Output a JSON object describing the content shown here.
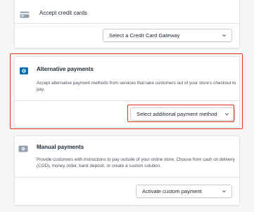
{
  "credit_cards": {
    "title": "Accept credit cards",
    "select_label": "Select a Credit Card Gateway",
    "icon": "credit-card-icon"
  },
  "alternative": {
    "title": "Alternative payments",
    "description": "Accept alternative payment methods from services that take customers out of your store’s checkout to pay.",
    "select_label": "Select additional payment method",
    "icon": "alternative-payment-icon"
  },
  "manual": {
    "title": "Manual payments",
    "description": "Provide customers with instructions to pay outside of your online store. Choose from cash on delivery (COD), money order, bank deposit, or create a custom solution.",
    "select_label": "Activate custom payment",
    "icon": "cash-icon"
  },
  "colors": {
    "highlight": "#de3618",
    "accent_icon": "#006fbb"
  }
}
